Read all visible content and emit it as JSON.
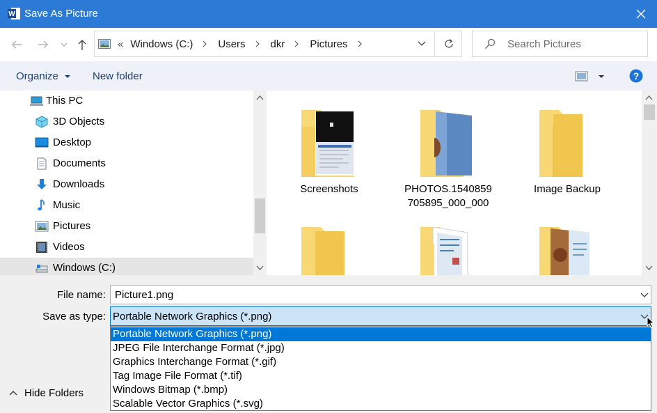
{
  "window": {
    "title": "Save As Picture",
    "app_icon": "word-icon",
    "close_icon": "close-icon"
  },
  "nav": {
    "back_icon": "back-arrow-icon",
    "forward_icon": "forward-arrow-icon",
    "recent_icon": "chevron-down-icon",
    "up_icon": "up-arrow-icon",
    "breadcrumb": [
      "Windows (C:)",
      "Users",
      "dkr",
      "Pictures"
    ],
    "breadcrumb_overflow": "«",
    "refresh_icon": "refresh-icon",
    "search_placeholder": "Search Pictures"
  },
  "toolbar": {
    "organize_label": "Organize",
    "new_folder_label": "New folder",
    "view_icon": "view-options-icon",
    "help_label": "?"
  },
  "sidebar": {
    "items": [
      {
        "label": "This PC",
        "icon": "this-pc-icon"
      },
      {
        "label": "3D Objects",
        "icon": "3d-objects-icon"
      },
      {
        "label": "Desktop",
        "icon": "desktop-icon"
      },
      {
        "label": "Documents",
        "icon": "documents-icon"
      },
      {
        "label": "Downloads",
        "icon": "downloads-icon"
      },
      {
        "label": "Music",
        "icon": "music-icon"
      },
      {
        "label": "Pictures",
        "icon": "pictures-icon"
      },
      {
        "label": "Videos",
        "icon": "videos-icon"
      },
      {
        "label": "Windows (C:)",
        "icon": "drive-icon",
        "selected": true
      }
    ]
  },
  "files": {
    "items": [
      {
        "label": "Screenshots",
        "icon": "folder-icon"
      },
      {
        "label": "PHOTOS.1540859705895_000_000",
        "line1": "PHOTOS.1540859",
        "line2": "705895_000_000",
        "icon": "folder-icon"
      },
      {
        "label": "Image Backup",
        "icon": "folder-icon"
      },
      {
        "label": "",
        "icon": "folder-icon"
      },
      {
        "label": "",
        "icon": "folder-icon"
      },
      {
        "label": "",
        "icon": "folder-icon"
      }
    ]
  },
  "form": {
    "file_name_label": "File name:",
    "file_name_value": "Picture1.png",
    "save_type_label": "Save as type:",
    "save_type_value": "Portable Network Graphics (*.png)",
    "save_type_options": [
      "Portable Network Graphics (*.png)",
      "JPEG File Interchange Format (*.jpg)",
      "Graphics Interchange Format (*.gif)",
      "Tag Image File Format (*.tif)",
      "Windows Bitmap (*.bmp)",
      "Scalable Vector Graphics (*.svg)"
    ],
    "selected_option_index": 0,
    "hide_folders_label": "Hide Folders"
  },
  "colors": {
    "titlebar": "#2b7bd6",
    "selection": "#0078d7",
    "toolbar_bg": "#eef1f7",
    "folder_yellow": "#f8d775"
  }
}
